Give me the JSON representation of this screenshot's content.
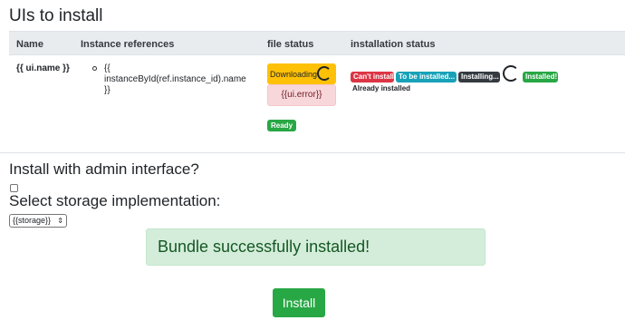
{
  "page_title": "UIs to install",
  "table": {
    "headers": [
      "Name",
      "Instance references",
      "file status",
      "installation status"
    ],
    "row": {
      "name": "{{ ui.name }}",
      "instance_ref": "{{ instanceById(ref.instance_id).name }}",
      "file_status": {
        "downloading": "Downloading",
        "error": "{{ui.error}}",
        "ready": "Ready"
      },
      "installation_status": {
        "cant_install": "Can't install",
        "to_be_installed": "To be installed...",
        "installing": "Installing...",
        "installed": "Installed!",
        "already_installed": "Already installed"
      }
    }
  },
  "admin": {
    "label": "Install with admin interface?",
    "checked": false
  },
  "storage": {
    "label": "Select storage implementation:",
    "value": "{{storage}}"
  },
  "alert": {
    "message": "Bundle successfully installed!"
  },
  "install_button": "Install",
  "colors": {
    "success": "#28a745",
    "warning": "#ffc107",
    "danger": "#dc3545",
    "info": "#17a2b8",
    "dark": "#343a40",
    "alert_success_bg": "#d4edda",
    "alert_danger_bg": "#f8d7da"
  }
}
